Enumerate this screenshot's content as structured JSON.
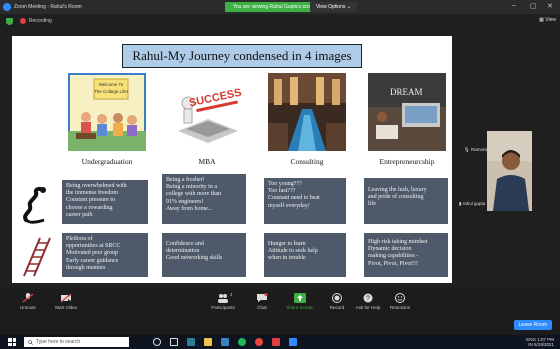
{
  "window": {
    "title": "Zoom Meeting - Rahul's Room",
    "banner": "You are viewing Rahul Gupta's screen",
    "view_options": "View Options ⌄",
    "recording": "Recording",
    "view_button": "View"
  },
  "slide": {
    "title": "Rahul-My Journey condensed in 4 images",
    "columns": [
      {
        "label": "Undergraduation",
        "image_text": [
          "Welcome To",
          "The College Life!"
        ]
      },
      {
        "label": "MBA",
        "image_text": [
          "SUCCESS"
        ]
      },
      {
        "label": "Consulting",
        "image_text": []
      },
      {
        "label": "Entrepreneurcship",
        "image_text": [
          "DREAM"
        ]
      }
    ],
    "row1": [
      [
        "Being overwhelmed with",
        "the immense freedom",
        "Constant pressure to",
        "choose a rewarding",
        "career path"
      ],
      [
        "Being a fresher!",
        "Being a minority in a",
        "college with more than",
        "91% engineers!",
        "Away from home..."
      ],
      [
        "Too young???",
        "Too fast???",
        "Constant need to beat",
        "myself everyday!"
      ],
      [
        "Leaving the lush,  luxury",
        "and pride of consulting",
        "life"
      ]
    ],
    "row2": [
      [
        "Plethora of",
        "opportunities at SRCC",
        "Motivated peer group",
        "Early career guidance",
        "through mentors"
      ],
      [
        "Confidence and",
        "determination",
        "Good networking skills"
      ],
      [
        "Hunger to learn",
        "Attitude to seek help",
        "when in trouble"
      ],
      [
        "High risk taking mindset",
        "Dynamic decision",
        "making capabilities -",
        "Pivot, Pivot, Pivot!!!"
      ]
    ]
  },
  "participants": {
    "first": "Ramone",
    "second": "rahul gupta"
  },
  "toolbar": {
    "unmute": "Unmute",
    "start_video": "Start Video",
    "participants": "Participants",
    "participants_count": "4",
    "chat": "Chat",
    "share_screen": "Share Screen",
    "record": "Record",
    "ask_for_help": "Ask for Help",
    "reactions": "Reactions",
    "leave_room": "Leave Room"
  },
  "taskbar": {
    "search_placeholder": "Type here to search",
    "lang": "ENG",
    "region": "IN",
    "time": "1:07 PM",
    "date": "5/19/2021"
  },
  "colors": {
    "accent": "#2d8cff",
    "banner": "#3cb043",
    "box": "#4e5a6a",
    "title_bg": "#aecbe8"
  }
}
